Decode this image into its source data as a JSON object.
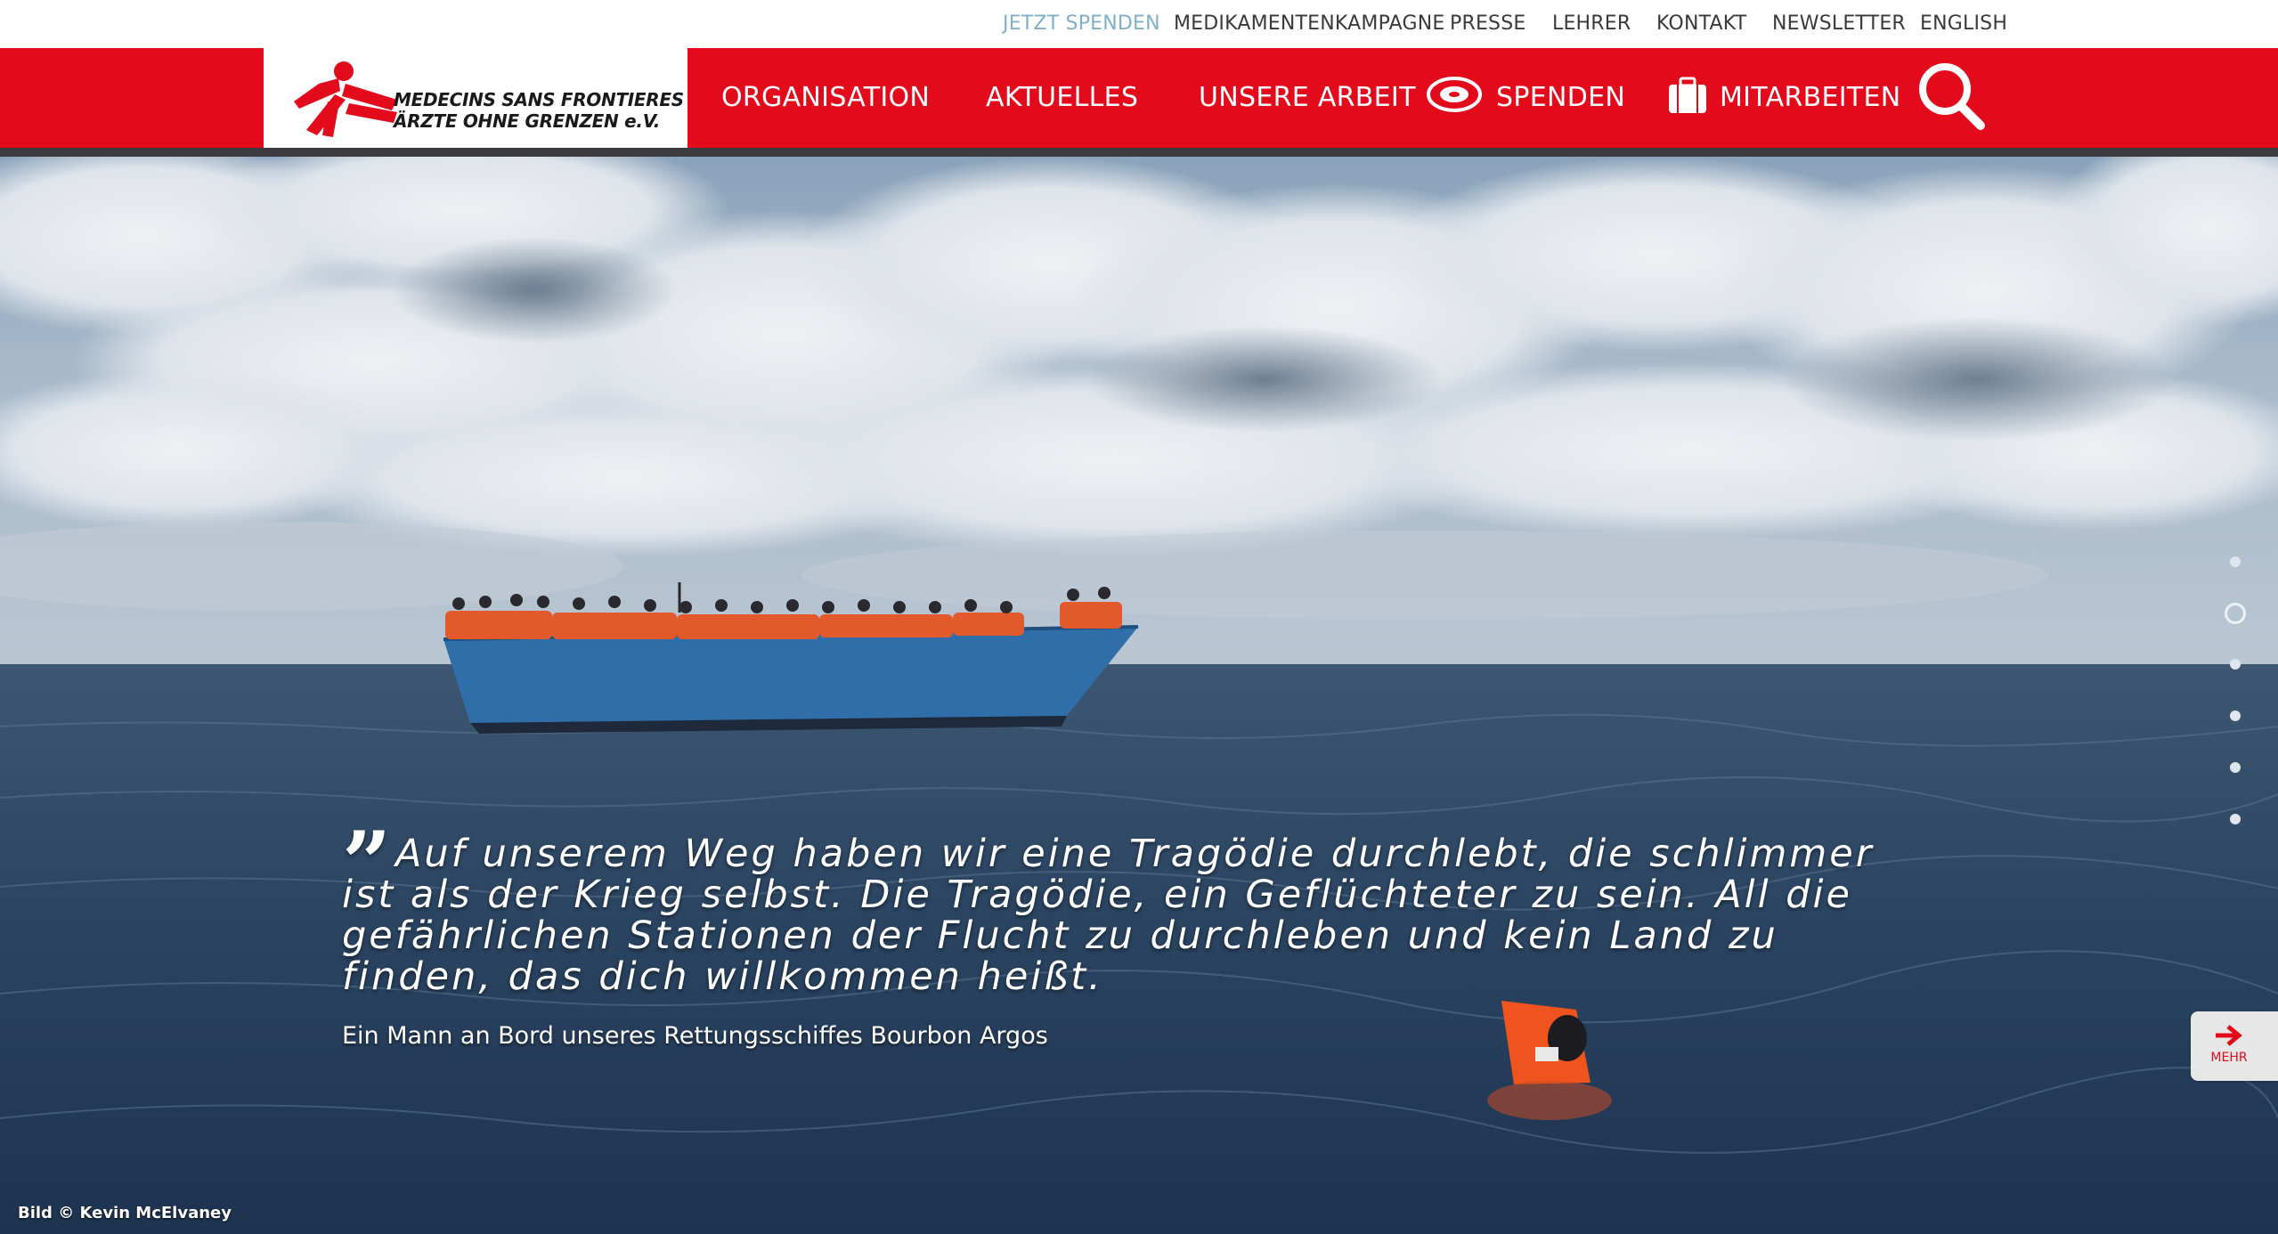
{
  "topbar": {
    "links": [
      {
        "label": "JETZT SPENDEN"
      },
      {
        "label": "MEDIKAMENTENKAMPAGNE"
      },
      {
        "label": "PRESSE"
      },
      {
        "label": "LEHRER"
      },
      {
        "label": "KONTAKT"
      },
      {
        "label": "NEWSLETTER"
      },
      {
        "label": "ENGLISH"
      }
    ]
  },
  "logo": {
    "line1": "MEDECINS SANS FRONTIERES",
    "line2": "ÄRZTE OHNE GRENZEN e.V."
  },
  "nav": {
    "items": [
      {
        "label": "ORGANISATION"
      },
      {
        "label": "AKTUELLES"
      },
      {
        "label": "UNSERE ARBEIT"
      },
      {
        "label": "SPENDEN",
        "icon": "donation-icon"
      },
      {
        "label": "MITARBEITEN",
        "icon": "briefcase-icon"
      }
    ],
    "search_icon": "search-icon"
  },
  "hero": {
    "quote": "Auf unserem Weg haben wir eine Tragödie durchlebt, die schlimmer ist als der Krieg selbst. Die Tragödie, ein Geflüchteter zu sein. All die gefährlichen Stationen der Flucht zu durchleben und kein Land zu finden, das dich willkommen heißt.",
    "caption": "Ein Mann an Bord unseres Rettungsschiffes Bourbon Argos",
    "credit": "Bild © Kevin McElvaney",
    "more_label": "MEHR",
    "slide_count": 6,
    "active_slide": 2
  },
  "colors": {
    "brand_red": "#e30a1b",
    "accent_link": "#7fb0c6"
  }
}
